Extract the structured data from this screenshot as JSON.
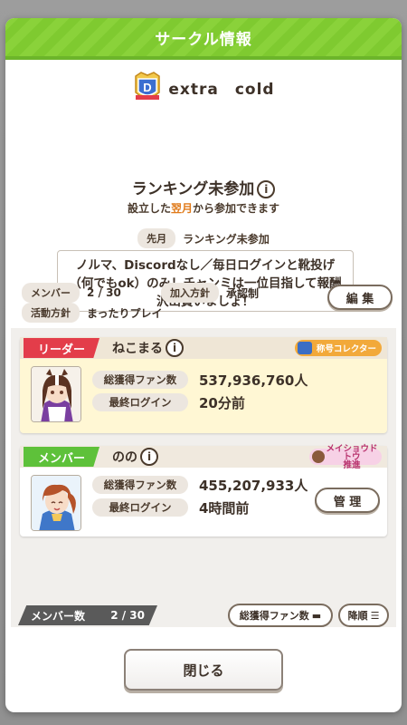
{
  "dialog": {
    "title": "サークル情報"
  },
  "circle": {
    "name": "extra　cold",
    "ranking_status": "ランキング未参加",
    "join_note_hl": "翌月",
    "join_note_pre": "設立した",
    "join_note_post": "から参加できます",
    "last_month_label": "先月",
    "last_month_value": "ランキング未参加",
    "message": "ノルマ、Discordなし／毎日ログインと靴投げ（何でもok）のみ！チャンミは一位目指して報酬沢山貰いましょ！",
    "members_label": "メンバー",
    "members_value": "2 / 30",
    "join_policy_label": "加入方針",
    "join_policy_value": "承認制",
    "activity_label": "活動方針",
    "activity_value": "まったりプレイ",
    "edit_label": "編 集"
  },
  "members": [
    {
      "role": "リーダー",
      "name": "ねこまる",
      "badge": "称号コレクター",
      "fans_label": "総獲得ファン数",
      "fans_value": "537,936,760人",
      "login_label": "最終ログイン",
      "login_value": "20分前"
    },
    {
      "role": "メンバー",
      "name": "のの",
      "badge_line1": "メイショウドトウ",
      "badge_line2": "推進",
      "fans_label": "総獲得ファン数",
      "fans_value": "455,207,933人",
      "login_label": "最終ログイン",
      "login_value": "4時間前",
      "manage_label": "管 理"
    }
  ],
  "footer": {
    "count_label": "メンバー数",
    "count_value": "2 / 30",
    "sort_fans_label": "総獲得ファン数",
    "sort_order_label": "降順",
    "close_label": "閉じる"
  },
  "colors": {
    "header_green": "#8ad23a",
    "leader_red": "#e33d4a",
    "member_green": "#5ec13a",
    "highlight_orange": "#e07a1a"
  }
}
